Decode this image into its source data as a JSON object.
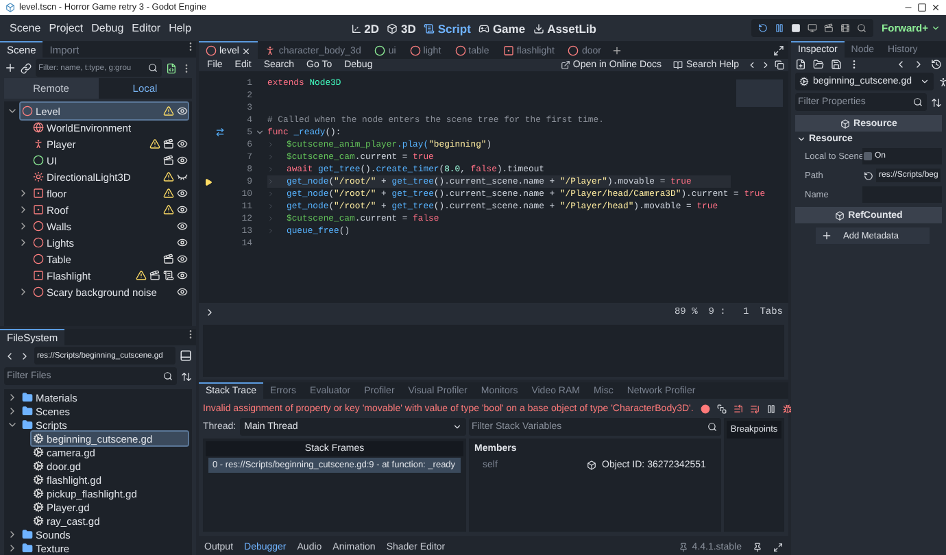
{
  "window": {
    "title": "level.tscn - Horror Game retry 3 - Godot Engine"
  },
  "menu": [
    "Scene",
    "Project",
    "Debug",
    "Editor",
    "Help"
  ],
  "workspaces": [
    {
      "kind": "canvas",
      "label": "2D",
      "selected": false
    },
    {
      "kind": "spatial",
      "label": "3D",
      "selected": false
    },
    {
      "kind": "script",
      "label": "Script",
      "selected": true
    },
    {
      "kind": "game",
      "label": "Game",
      "selected": false
    },
    {
      "kind": "assetlib",
      "label": "AssetLib",
      "selected": false
    }
  ],
  "renderer": "Forward+",
  "scene_dock": {
    "tabs": [
      {
        "label": "Scene",
        "selected": true
      },
      {
        "label": "Import",
        "selected": false
      }
    ],
    "filter": {
      "placeholder": "Filter: name, t:type, g:grou"
    },
    "modes": [
      {
        "label": "Remote",
        "selected": false
      },
      {
        "label": "Local",
        "selected": true
      }
    ],
    "tree": [
      {
        "name": "Level",
        "kind": "node3d",
        "selected": true,
        "expanded": true,
        "warning": true,
        "scene": false,
        "script": false,
        "visible": true,
        "children": [
          {
            "name": "WorldEnvironment",
            "kind": "environment",
            "selected": false,
            "warning": false,
            "scene": false,
            "script": false
          },
          {
            "name": "Player",
            "kind": "character",
            "selected": false,
            "warning": true,
            "scene": true,
            "script": false,
            "visible": true
          },
          {
            "name": "UI",
            "kind": "control",
            "selected": false,
            "warning": false,
            "scene": true,
            "script": false,
            "visible": true
          },
          {
            "name": "DirectionalLight3D",
            "kind": "light",
            "selected": false,
            "warning": true,
            "scene": false,
            "script": false,
            "visible": false
          },
          {
            "name": "floor",
            "kind": "instance",
            "selected": false,
            "expanded": false,
            "warning": true,
            "scene": false,
            "script": false,
            "visible": true
          },
          {
            "name": "Roof",
            "kind": "instance",
            "selected": false,
            "expanded": false,
            "warning": true,
            "scene": false,
            "script": false,
            "visible": true
          },
          {
            "name": "Walls",
            "kind": "node3d",
            "selected": false,
            "expanded": false,
            "warning": false,
            "scene": false,
            "script": false,
            "visible": true
          },
          {
            "name": "Lights",
            "kind": "node3d",
            "selected": false,
            "expanded": false,
            "warning": false,
            "scene": false,
            "script": false,
            "visible": true
          },
          {
            "name": "Table",
            "kind": "node3d",
            "selected": false,
            "warning": false,
            "scene": true,
            "script": false,
            "visible": true
          },
          {
            "name": "Flashlight",
            "kind": "instance",
            "selected": false,
            "warning": true,
            "scene": true,
            "script": true,
            "visible": true
          },
          {
            "name": "Scary background noise",
            "kind": "node3d",
            "selected": false,
            "expanded": false,
            "warning": false,
            "scene": false,
            "script": false,
            "visible": true
          }
        ]
      }
    ]
  },
  "filesystem": {
    "tab": "FileSystem",
    "path": "res://Scripts/beginning_cutscene.gd",
    "filter": {
      "placeholder": "Filter Files"
    },
    "tree": [
      {
        "name": "Materials",
        "kind": "folder",
        "selected": false,
        "expanded": false
      },
      {
        "name": "Scenes",
        "kind": "folder",
        "selected": false,
        "expanded": false
      },
      {
        "name": "Scripts",
        "kind": "folder",
        "selected": false,
        "expanded": true,
        "children": [
          {
            "name": "beginning_cutscene.gd",
            "kind": "script",
            "selected": true
          },
          {
            "name": "camera.gd",
            "kind": "script",
            "selected": false
          },
          {
            "name": "door.gd",
            "kind": "script",
            "selected": false
          },
          {
            "name": "flashlight.gd",
            "kind": "script",
            "selected": false
          },
          {
            "name": "pickup_flashlight.gd",
            "kind": "script",
            "selected": false
          },
          {
            "name": "Player.gd",
            "kind": "script",
            "selected": false
          },
          {
            "name": "ray_cast.gd",
            "kind": "script",
            "selected": false
          }
        ]
      },
      {
        "name": "Sounds",
        "kind": "folder",
        "selected": false,
        "expanded": false
      },
      {
        "name": "Texture",
        "kind": "folder",
        "selected": false,
        "expanded": false
      }
    ]
  },
  "script_tabs": [
    {
      "label": "level",
      "kind": "node3d",
      "selected": true
    },
    {
      "label": "character_body_3d",
      "kind": "character",
      "selected": false
    },
    {
      "label": "ui",
      "kind": "control",
      "selected": false
    },
    {
      "label": "light",
      "kind": "node3d",
      "selected": false
    },
    {
      "label": "table",
      "kind": "node3d",
      "selected": false
    },
    {
      "label": "flashlight",
      "kind": "instance",
      "selected": false
    },
    {
      "label": "door",
      "kind": "node3d",
      "selected": false
    }
  ],
  "script_menu": [
    "File",
    "Edit",
    "Search",
    "Go To",
    "Debug"
  ],
  "script_links": [
    {
      "kind": "docs",
      "label": "Open in Online Docs"
    },
    {
      "kind": "help",
      "label": "Search Help"
    }
  ],
  "code": [
    {
      "number": "1",
      "current": false,
      "executing": false,
      "connected": false,
      "indented": false,
      "segments": [
        {
          "kind": "keyword",
          "text": "extends "
        },
        {
          "kind": "class",
          "text": "Node3D"
        }
      ]
    },
    {
      "number": "2",
      "current": false,
      "executing": false,
      "connected": false,
      "indented": false
    },
    {
      "number": "3",
      "current": false,
      "executing": false,
      "connected": false,
      "indented": false
    },
    {
      "number": "4",
      "current": false,
      "executing": false,
      "connected": false,
      "indented": false,
      "segments": [
        {
          "kind": "comment",
          "text": "# Called when the node enters the scene tree for the first time."
        }
      ]
    },
    {
      "number": "5",
      "current": false,
      "indented": false,
      "executing": false,
      "connected": true,
      "folded": false,
      "segments": [
        {
          "kind": "keyword",
          "text": "func "
        },
        {
          "kind": "func",
          "text": "_ready"
        },
        {
          "kind": "plain",
          "text": "():"
        }
      ]
    },
    {
      "number": "6",
      "current": false,
      "executing": false,
      "connected": false,
      "indented": true,
      "segments": [
        {
          "kind": "node",
          "text": "$cutscene_anim_player"
        },
        {
          "kind": "func",
          "text": ".play("
        },
        {
          "kind": "string",
          "text": "\"beginning\""
        },
        {
          "kind": "plain",
          "text": ")"
        }
      ]
    },
    {
      "number": "7",
      "current": false,
      "executing": false,
      "connected": false,
      "indented": true,
      "segments": [
        {
          "kind": "node",
          "text": "$cutscene_cam"
        },
        {
          "kind": "plain",
          "text": ".current = "
        },
        {
          "kind": "keyword",
          "text": "true"
        }
      ]
    },
    {
      "number": "8",
      "current": false,
      "executing": false,
      "connected": false,
      "indented": true,
      "segments": [
        {
          "kind": "keyword",
          "text": "await "
        },
        {
          "kind": "func",
          "text": "get_tree"
        },
        {
          "kind": "plain",
          "text": "()."
        },
        {
          "kind": "func",
          "text": "create_timer"
        },
        {
          "kind": "plain",
          "text": "("
        },
        {
          "kind": "number",
          "text": "8.0"
        },
        {
          "kind": "plain",
          "text": ", "
        },
        {
          "kind": "keyword",
          "text": "false"
        },
        {
          "kind": "plain",
          "text": ").timeout"
        }
      ]
    },
    {
      "number": "9",
      "current": true,
      "indented": true,
      "executing": true,
      "connected": false,
      "segments": [
        {
          "kind": "func",
          "text": "get_node"
        },
        {
          "kind": "plain",
          "text": "("
        },
        {
          "kind": "string",
          "text": "\"/root/\""
        },
        {
          "kind": "plain",
          "text": " + "
        },
        {
          "kind": "func",
          "text": "get_tree"
        },
        {
          "kind": "plain",
          "text": "().current_scene.name + "
        },
        {
          "kind": "string",
          "text": "\"/Player\""
        },
        {
          "kind": "plain",
          "text": ").movable = "
        },
        {
          "kind": "keyword",
          "text": "true"
        }
      ]
    },
    {
      "number": "10",
      "current": false,
      "executing": false,
      "connected": false,
      "indented": true,
      "segments": [
        {
          "kind": "func",
          "text": "get_node"
        },
        {
          "kind": "plain",
          "text": "("
        },
        {
          "kind": "string",
          "text": "\"/root/\""
        },
        {
          "kind": "plain",
          "text": " + "
        },
        {
          "kind": "func",
          "text": "get_tree"
        },
        {
          "kind": "plain",
          "text": "().current_scene.name + "
        },
        {
          "kind": "string",
          "text": "\"/Player/head/Camera3D\""
        },
        {
          "kind": "plain",
          "text": ").current = "
        },
        {
          "kind": "keyword",
          "text": "true"
        }
      ]
    },
    {
      "number": "11",
      "current": false,
      "executing": false,
      "connected": false,
      "indented": true,
      "segments": [
        {
          "kind": "func",
          "text": "get_node"
        },
        {
          "kind": "plain",
          "text": "("
        },
        {
          "kind": "string",
          "text": "\"/root/\""
        },
        {
          "kind": "plain",
          "text": " + "
        },
        {
          "kind": "func",
          "text": "get_tree"
        },
        {
          "kind": "plain",
          "text": "().current_scene.name + "
        },
        {
          "kind": "string",
          "text": "\"/Player/head\""
        },
        {
          "kind": "plain",
          "text": ").movable = "
        },
        {
          "kind": "keyword",
          "text": "true"
        }
      ]
    },
    {
      "number": "12",
      "current": false,
      "executing": false,
      "connected": false,
      "indented": true,
      "segments": [
        {
          "kind": "node",
          "text": "$cutscene_cam"
        },
        {
          "kind": "plain",
          "text": ".current = "
        },
        {
          "kind": "keyword",
          "text": "false"
        }
      ]
    },
    {
      "number": "13",
      "current": false,
      "executing": false,
      "connected": false,
      "indented": true,
      "segments": [
        {
          "kind": "func",
          "text": "queue_free"
        },
        {
          "kind": "plain",
          "text": "()"
        }
      ]
    },
    {
      "number": "14",
      "current": false,
      "executing": false,
      "connected": false,
      "indented": false
    }
  ],
  "status": {
    "zoom": "89 %",
    "position": "9 :   1",
    "indent": "Tabs"
  },
  "debugger": {
    "tabs": [
      {
        "label": "Stack Trace",
        "selected": true
      },
      {
        "label": "Errors",
        "selected": false
      },
      {
        "label": "Evaluator",
        "selected": false
      },
      {
        "label": "Profiler",
        "selected": false
      },
      {
        "label": "Visual Profiler",
        "selected": false
      },
      {
        "label": "Monitors",
        "selected": false
      },
      {
        "label": "Video RAM",
        "selected": false
      },
      {
        "label": "Misc",
        "selected": false
      },
      {
        "label": "Network Profiler",
        "selected": false
      }
    ],
    "error": "Invalid assignment of property or key 'movable' with value of type 'bool' on a base object of type 'CharacterBody3D'.",
    "thread_label": "Thread:",
    "thread": "Main Thread",
    "filter": {
      "placeholder": "Filter Stack Variables"
    },
    "breakpoints": "Breakpoints",
    "frames_header": "Stack Frames",
    "frames": [
      {
        "text": "0 - res://Scripts/beginning_cutscene.gd:9 - at function: _ready",
        "selected": true
      }
    ],
    "members_header": "Members",
    "members": [
      {
        "name": "self",
        "value": "Object ID: 36272342551"
      }
    ]
  },
  "bottom_tabs": [
    {
      "label": "Output",
      "selected": false
    },
    {
      "label": "Debugger",
      "selected": true
    },
    {
      "label": "Audio",
      "selected": false
    },
    {
      "label": "Animation",
      "selected": false
    },
    {
      "label": "Shader Editor",
      "selected": false
    }
  ],
  "version": "4.4.1.stable",
  "inspector": {
    "tabs": [
      {
        "label": "Inspector",
        "selected": true
      },
      {
        "label": "Node",
        "selected": false
      },
      {
        "label": "History",
        "selected": false
      }
    ],
    "object": "beginning_cutscene.gd",
    "filter": {
      "placeholder": "Filter Properties"
    },
    "rows": [
      {
        "kind": "category",
        "label": "Resource"
      },
      {
        "kind": "group",
        "label": "Resource",
        "expanded": true
      },
      {
        "kind": "checkbox",
        "label": "Local to Scene",
        "checked": false,
        "text": "On"
      },
      {
        "kind": "path",
        "label": "Path",
        "value": "res://Scripts/beg"
      },
      {
        "kind": "text",
        "label": "Name"
      },
      {
        "kind": "category",
        "label": "RefCounted"
      },
      {
        "kind": "button",
        "label": "Add Metadata"
      }
    ]
  }
}
